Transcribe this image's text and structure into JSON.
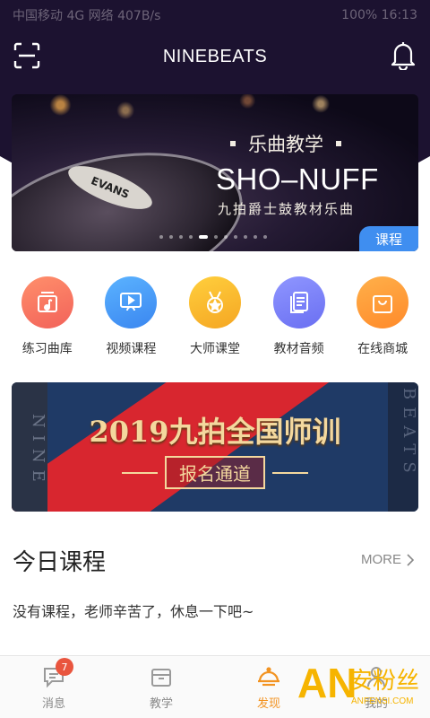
{
  "status_bar": {
    "left": "中国移动 4G 网络 407B/s",
    "right": "100% 16:13"
  },
  "app_bar": {
    "title": "NINEBEATS",
    "scan_icon": "scan-icon",
    "bell_icon": "bell-icon"
  },
  "hero": {
    "subtitle": "乐曲教学",
    "title": "SHO–NUFF",
    "description": "九拍爵士鼓教材乐曲",
    "tag": "课程",
    "drum_logo": "EVANS",
    "page_count": 11,
    "active_page": 4
  },
  "categories": [
    {
      "label": "练习曲库",
      "icon": "music-library-icon",
      "color_from": "#ff8f6b",
      "color_to": "#f2625a"
    },
    {
      "label": "视频课程",
      "icon": "video-course-icon",
      "color_from": "#5bb3ff",
      "color_to": "#3a86f0"
    },
    {
      "label": "大师课堂",
      "icon": "master-medal-icon",
      "color_from": "#ffcf3d",
      "color_to": "#f5a623"
    },
    {
      "label": "教材音频",
      "icon": "audio-doc-icon",
      "color_from": "#8f96ff",
      "color_to": "#6a6ff2"
    },
    {
      "label": "在线商城",
      "icon": "shopping-bag-icon",
      "color_from": "#ffb04a",
      "color_to": "#ff8a2a"
    }
  ],
  "promo": {
    "title": "2019九拍全国师训",
    "button": "报名通道",
    "side_left": "NINE",
    "side_right": "BEATS"
  },
  "today": {
    "title": "今日课程",
    "more": "MORE",
    "empty": "没有课程，老师辛苦了，休息一下吧~"
  },
  "bottom_nav": [
    {
      "label": "消息",
      "icon": "message-icon",
      "badge": "7"
    },
    {
      "label": "教学",
      "icon": "teaching-box-icon"
    },
    {
      "label": "发现",
      "icon": "discover-icon",
      "active": true
    },
    {
      "label": "我的",
      "icon": "profile-icon"
    }
  ],
  "watermark": {
    "an": "AN",
    "cn": "安粉丝",
    "en": "ANFENSI.COM"
  },
  "colors": {
    "header": "#1c1230",
    "accent": "#f29321",
    "tag_blue": "#3f8ef0"
  }
}
